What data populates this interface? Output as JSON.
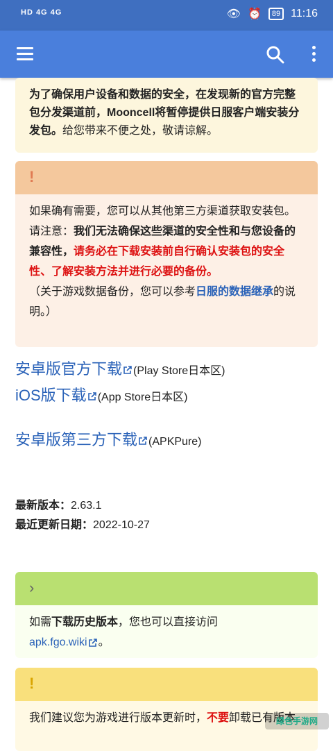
{
  "statusbar": {
    "left_indicators": "HD 4G 4G",
    "battery": "89",
    "time": "11:16"
  },
  "appbar": {
    "menu_icon": "hamburger-icon",
    "search_icon": "search-icon",
    "more_icon": "more-vert-icon"
  },
  "notice1": {
    "bold_text": "为了确保用户设备和数据的安全，在发现新的官方完整包分发渠道前，Mooncell将暂停提供日服客户端安装分发包。",
    "text": "给您带来不便之处，敬请谅解。"
  },
  "notice2": {
    "icon": "!",
    "line1": "如果确有需要，您可以从其他第三方渠道获取安装包。",
    "label": "请注意：",
    "bold": "我们无法确保这些渠道的安全性和与您设备的兼容性，",
    "red": "请务必在下载安装前自行确认安装包的安全性、了解安装方法并进行必要的备份。",
    "note_prefix": "（关于游戏数据备份，您可以参考",
    "note_link": "日服的数据继承",
    "note_suffix": "的说明。）"
  },
  "download_links": [
    {
      "text": "安卓版官方下载",
      "suffix": "(Play Store日本区)"
    },
    {
      "text": "iOS版下载",
      "suffix": "(App Store日本区)"
    },
    {
      "text": "安卓版第三方下载",
      "suffix": "(APKPure)"
    }
  ],
  "version": {
    "latest_label": "最新版本：",
    "latest_value": "2.63.1",
    "updated_label": "最近更新日期：",
    "updated_value": "2022-10-27"
  },
  "notice3": {
    "icon": "›",
    "prefix": "如需",
    "bold": "下载历史版本",
    "mid": "，您也可以直接访问",
    "link": "apk.fgo.wiki",
    "suffix": "。"
  },
  "notice4": {
    "icon": "!",
    "prefix": "我们建议您为游戏进行版本更新时，",
    "red": "不要",
    "suffix": "卸载已有版本"
  },
  "watermark": "绿色手游网"
}
